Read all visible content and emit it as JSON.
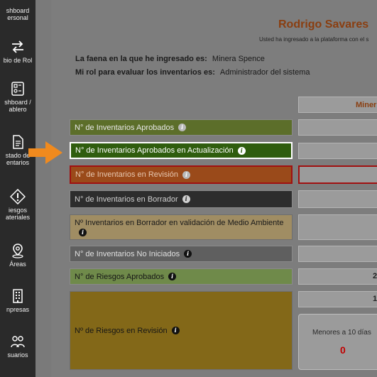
{
  "sidebar": {
    "items": [
      {
        "label": "shboard\nersonal",
        "icon": "dashboard-personal-icon"
      },
      {
        "label": "bio de Rol",
        "icon": "swap-arrows-icon"
      },
      {
        "label": "shboard /\nablero",
        "icon": "dashboard-board-icon"
      },
      {
        "label": "stado de\nentarios",
        "icon": "document-icon"
      },
      {
        "label": "iesgos\nateriales",
        "icon": "risk-diamond-icon"
      },
      {
        "label": "Áreas",
        "icon": "map-pin-icon"
      },
      {
        "label": "npresas",
        "icon": "building-icon"
      },
      {
        "label": "suarios",
        "icon": "users-icon"
      }
    ]
  },
  "header": {
    "title": "Rodrigo Savares",
    "subtitle": "Usted ha ingresado a la plataforma con el s"
  },
  "info": {
    "faena_label": "La faena en la que he ingresado es:",
    "faena_value": "Minera Spence",
    "rol_label": "Mi rol para evaluar los inventarios es:",
    "rol_value": "Administrador del sistema"
  },
  "table": {
    "column_header": "Miner",
    "rows": [
      {
        "label": "N° de Inventarios Aprobados",
        "info_icon": "info-icon",
        "value": ""
      },
      {
        "label": "N° de Inventarios Aprobados en Actualización",
        "info_icon": "info-icon",
        "value": ""
      },
      {
        "label": "N° de Inventarios en Revisión",
        "info_icon": "info-icon",
        "value": ""
      },
      {
        "label": "N° de Inventarios en Borrador",
        "info_icon": "info-icon",
        "value": ""
      },
      {
        "label": "Nº Inventarios en Borrador en validación de Medio Ambiente",
        "info_icon": "info-icon",
        "value": ""
      },
      {
        "label": "N° de Inventarios No Iniciados",
        "info_icon": "info-icon",
        "value": ""
      },
      {
        "label": "N° de Riesgos Aprobados",
        "info_icon": "info-icon",
        "value": "2"
      },
      {
        "label": "Nº de Riesgos en Revisión",
        "info_icon": "info-icon",
        "value": "1"
      }
    ],
    "revision_sub": {
      "label": "Menores a 10 días",
      "value": "0"
    }
  },
  "colors": {
    "aprobados": "#5c6e2a",
    "actualizacion": "#2f5d0e",
    "revision": "#9a4a1a",
    "borrador": "#2d2d2d",
    "medio_ambiente": "#a08d63",
    "no_iniciados": "#5f5f5f",
    "riesgos_aprobados": "#6f8a4a",
    "riesgos_revision": "#836818",
    "title": "#8a3e10",
    "arrow": "#f08a1e",
    "red_value": "#c00000"
  }
}
